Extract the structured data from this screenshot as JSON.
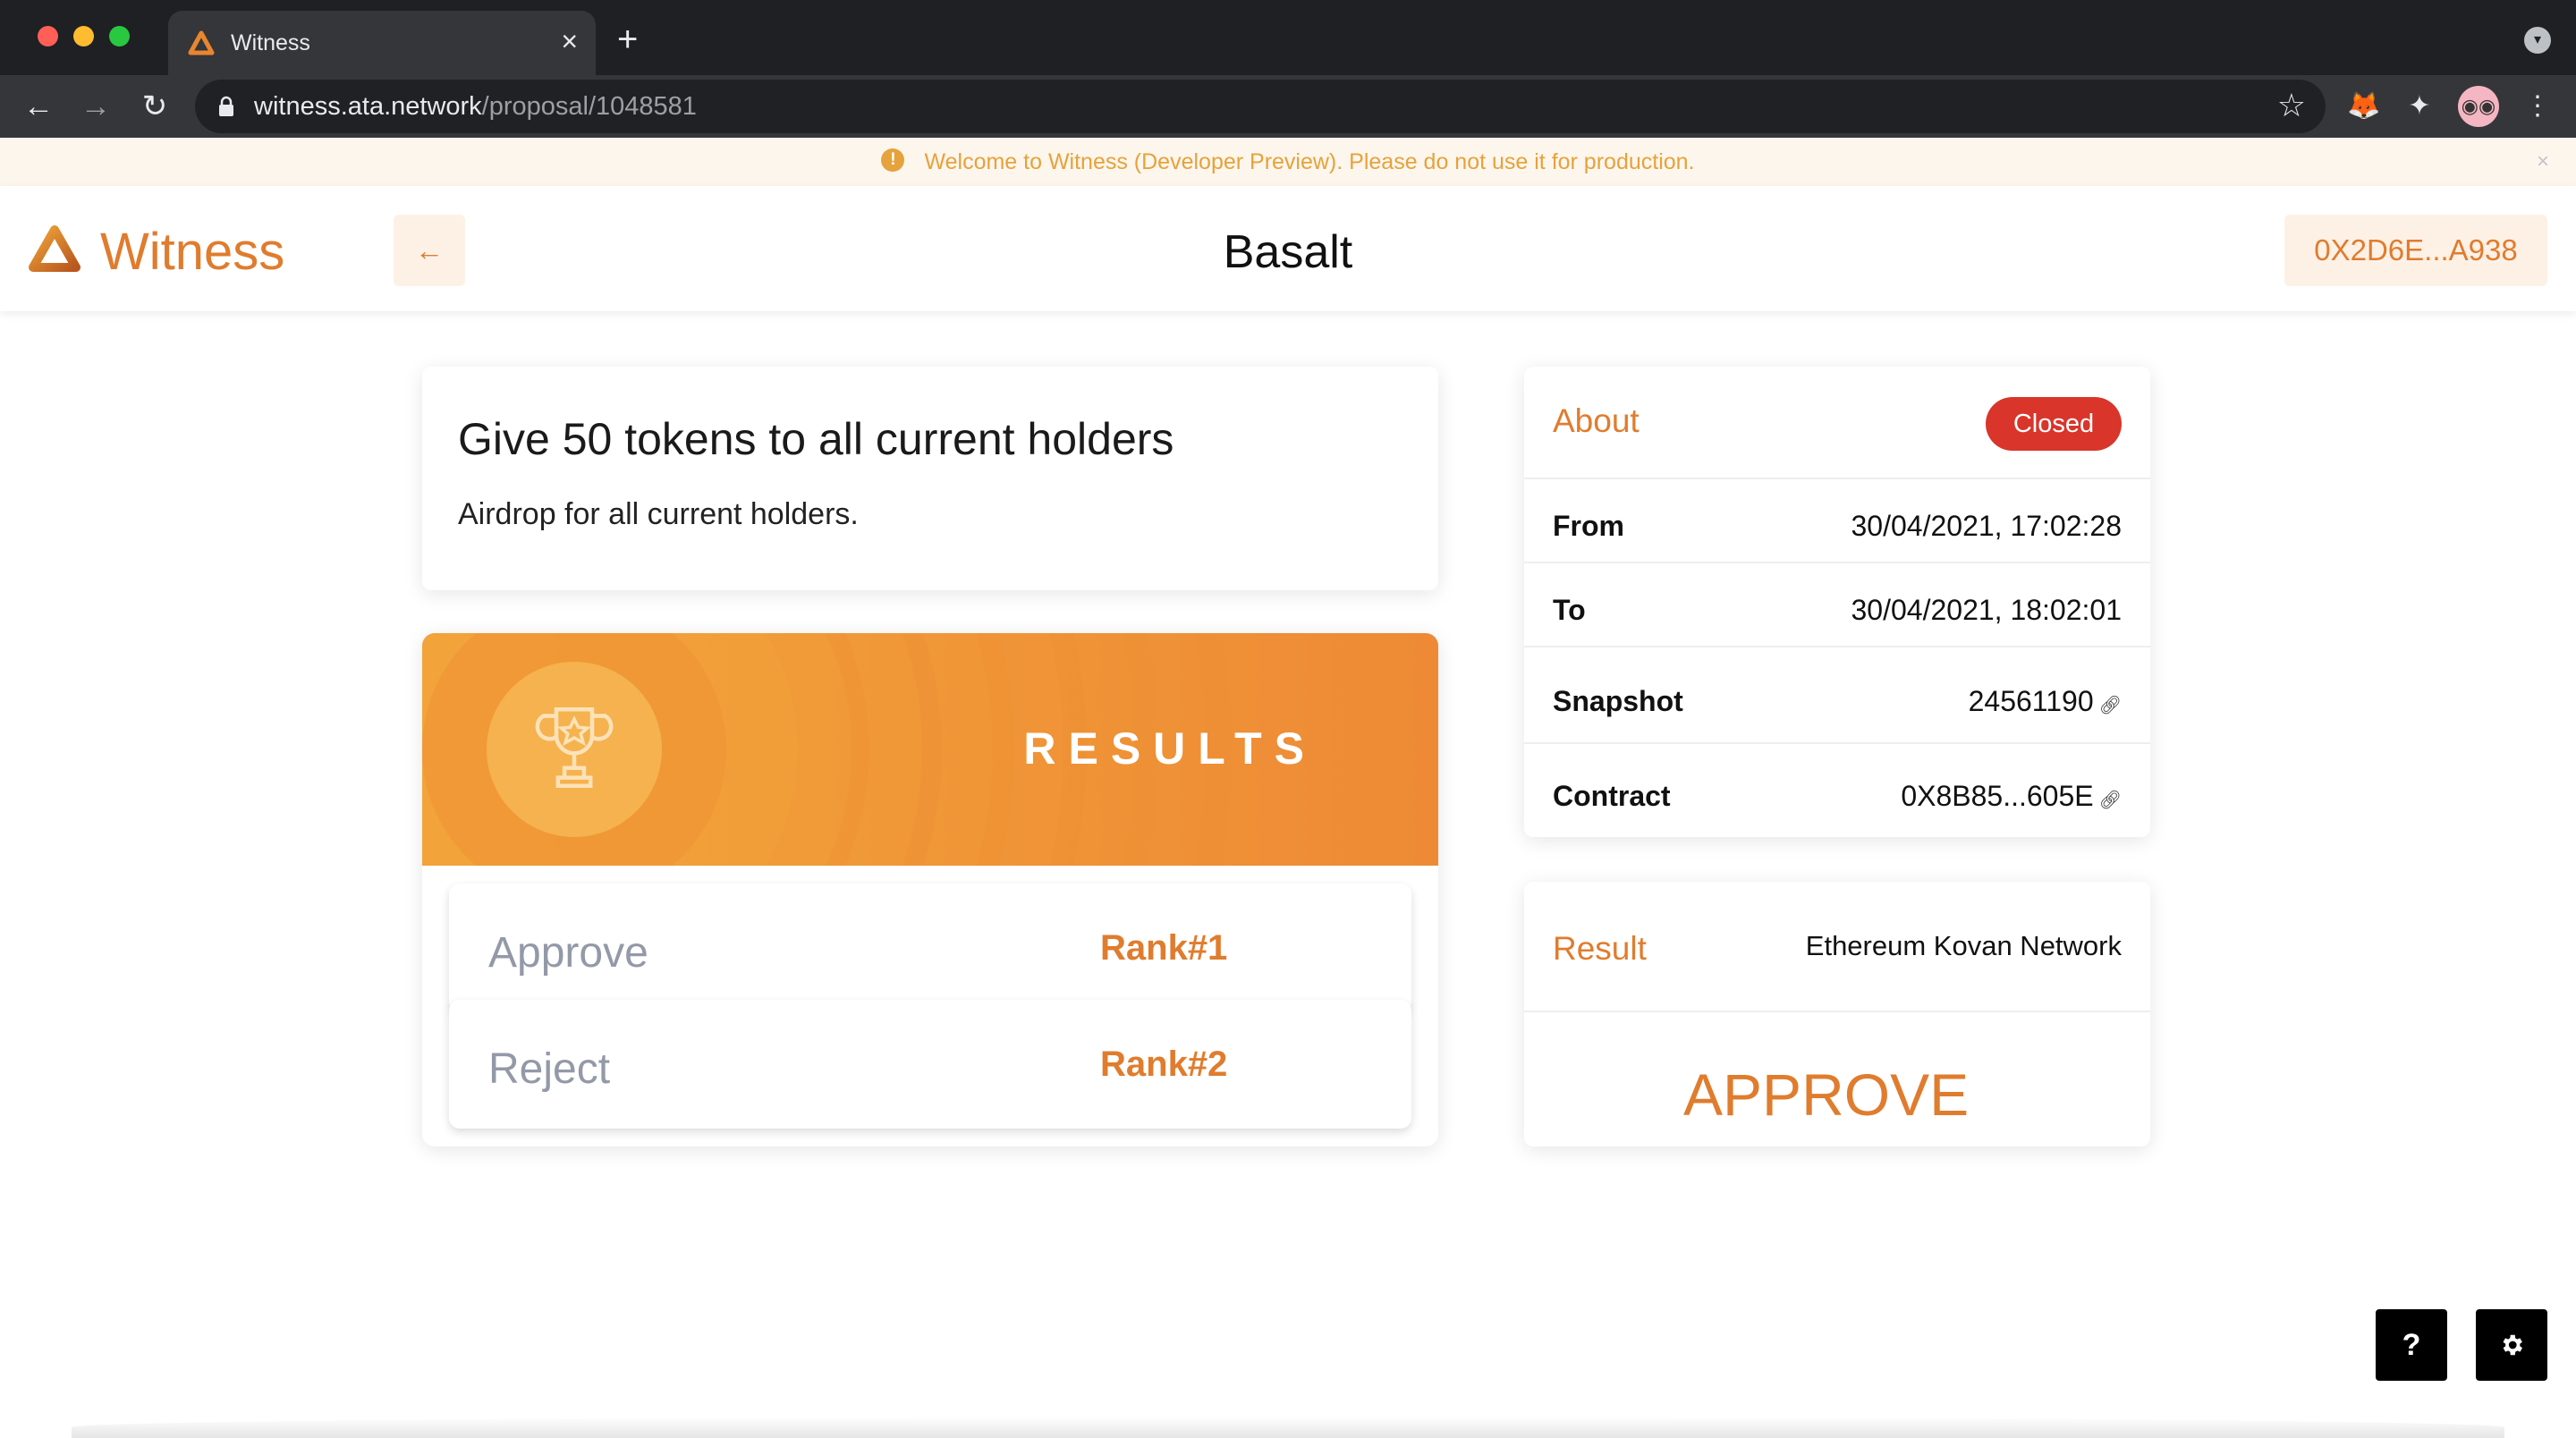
{
  "browser": {
    "tab_title": "Witness",
    "url_host": "witness.ata.network",
    "url_path": "/proposal/1048581"
  },
  "banner": {
    "message": "Welcome to Witness (Developer Preview). Please do not use it for production.",
    "icon": "warning-icon"
  },
  "header": {
    "logo_text": "Witness",
    "back_label": "←",
    "title": "Basalt",
    "wallet_address": "0X2D6E...A938"
  },
  "proposal": {
    "title": "Give 50 tokens to all current holders",
    "description": "Airdrop for all current holders."
  },
  "results": {
    "heading": "RESULTS",
    "options": [
      {
        "label": "Approve",
        "rank": "Rank#1"
      },
      {
        "label": "Reject",
        "rank": "Rank#2"
      }
    ]
  },
  "about": {
    "heading": "About",
    "status": "Closed",
    "rows": [
      {
        "label": "From",
        "value": "30/04/2021, 17:02:28"
      },
      {
        "label": "To",
        "value": "30/04/2021, 18:02:01"
      },
      {
        "label": "Snapshot",
        "value": "24561190"
      },
      {
        "label": "Contract",
        "value": "0X8B85...605E"
      }
    ]
  },
  "result": {
    "heading": "Result",
    "network": "Ethereum Kovan Network",
    "outcome": "APPROVE"
  },
  "floating": {
    "help_label": "?",
    "settings_icon": "gear-icon"
  },
  "colors": {
    "accent": "#e07c2e",
    "closed_badge": "#d9352b",
    "banner_bg": "#fdf6ec",
    "banner_text": "#e6a23c"
  }
}
